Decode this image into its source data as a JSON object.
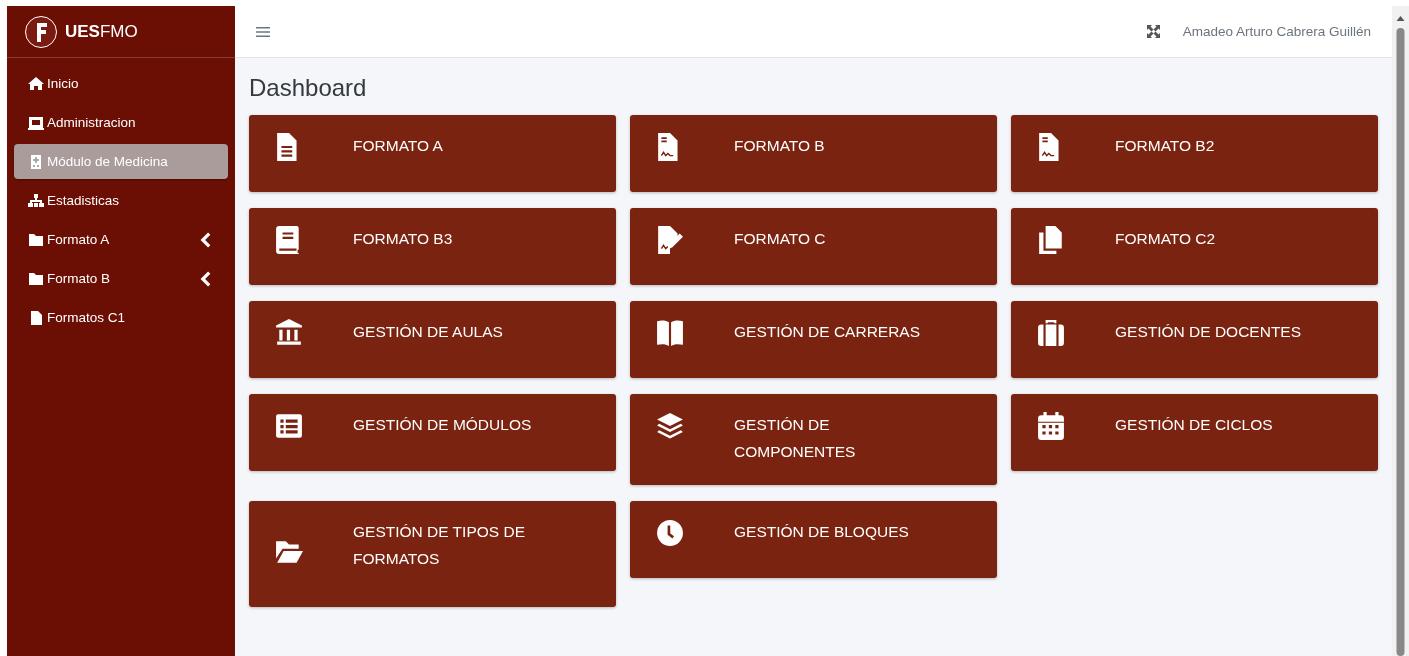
{
  "brand": {
    "title": "**UES**FMO"
  },
  "sidebar": {
    "items": [
      {
        "label": "Inicio",
        "kind": "link",
        "selected": false
      },
      {
        "label": "Administracion",
        "kind": "link",
        "selected": false
      },
      {
        "label": "Módulo de Medicina",
        "kind": "link",
        "selected": true
      },
      {
        "label": "Estadisticas",
        "kind": "link",
        "selected": false
      },
      {
        "label": "Formato A",
        "kind": "submenu",
        "selected": false,
        "expanded": false
      },
      {
        "label": "Formato B",
        "kind": "submenu",
        "selected": false,
        "expanded": false
      },
      {
        "label": "Formatos C1",
        "kind": "link",
        "selected": false
      }
    ]
  },
  "topbar": {
    "user": "Amadeo Arturo Cabrera Guillén"
  },
  "page": {
    "title": "Dashboard",
    "cards": [
      {
        "label": "FORMATO A"
      },
      {
        "label": "FORMATO B"
      },
      {
        "label": "FORMATO B2"
      },
      {
        "label": "FORMATO B3"
      },
      {
        "label": "FORMATO C"
      },
      {
        "label": "FORMATO C2"
      },
      {
        "label": "GESTIÓN DE AULAS"
      },
      {
        "label": "GESTIÓN DE CARRERAS"
      },
      {
        "label": "GESTIÓN DE DOCENTES"
      },
      {
        "label": "GESTIÓN DE MÓDULOS"
      },
      {
        "label": "GESTIÓN DE COMPONENTES"
      },
      {
        "label": "GESTIÓN DE CICLOS"
      },
      {
        "label": "GESTIÓN DE TIPOS DE FORMATOS"
      },
      {
        "label": "GESTIÓN DE BLOQUES"
      }
    ]
  }
}
